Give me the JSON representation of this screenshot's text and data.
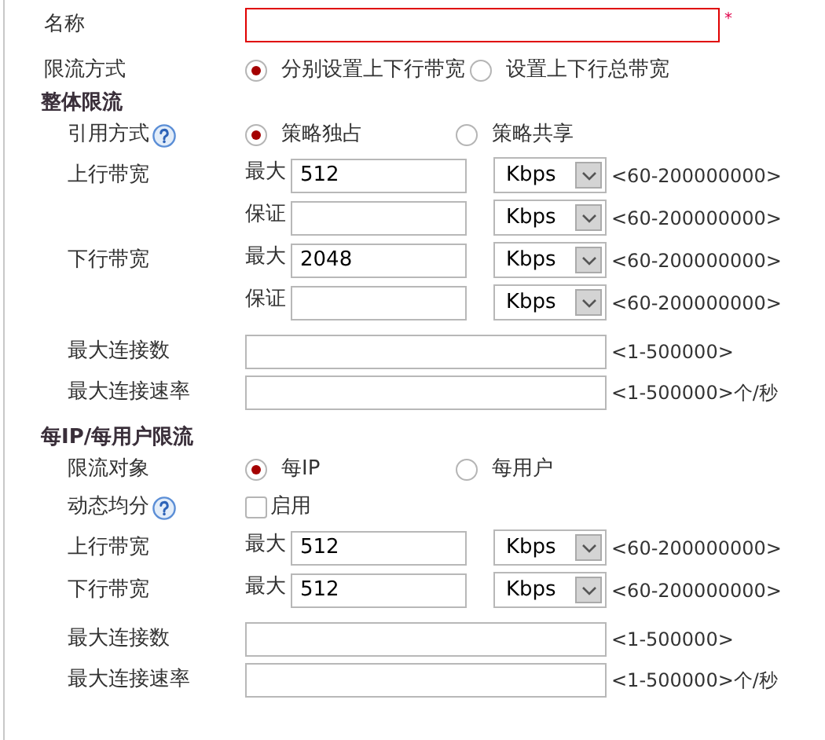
{
  "rows": [
    {
      "kind": "name",
      "label": "名称",
      "required_mark": "*",
      "invalid": true
    },
    {
      "kind": "radio",
      "label": "限流方式",
      "options": [
        {
          "label": "分别设置上下行带宽",
          "selected": true
        },
        {
          "label": "设置上下行总带宽",
          "selected": false
        }
      ]
    },
    {
      "kind": "heading",
      "label": "整体限流"
    },
    {
      "kind": "radio",
      "label": "引用方式",
      "help": true,
      "options": [
        {
          "label": "策略独占",
          "selected": true
        },
        {
          "label": "策略共享",
          "selected": false
        }
      ]
    },
    {
      "kind": "bandwidth",
      "label": "上行带宽",
      "lines": [
        {
          "sublabel": "最大",
          "value": "512",
          "unit": "Kbps",
          "range": "<60-200000000>"
        },
        {
          "sublabel": "保证",
          "unit": "Kbps",
          "range": "<60-200000000>"
        }
      ]
    },
    {
      "kind": "bandwidth",
      "label": "下行带宽",
      "lines": [
        {
          "sublabel": "最大",
          "value": "2048",
          "unit": "Kbps",
          "range": "<60-200000000>"
        },
        {
          "sublabel": "保证",
          "unit": "Kbps",
          "range": "<60-200000000>"
        }
      ]
    },
    {
      "kind": "wide",
      "label": "最大连接数",
      "range": "<1-500000>"
    },
    {
      "kind": "wide",
      "label": "最大连接速率",
      "range": "<1-500000>个/秒"
    },
    {
      "kind": "heading",
      "label": "每IP/每用户限流"
    },
    {
      "kind": "radio",
      "label": "限流对象",
      "options": [
        {
          "label": "每IP",
          "selected": true
        },
        {
          "label": "每用户",
          "selected": false
        }
      ]
    },
    {
      "kind": "checkbox",
      "label": "动态均分",
      "help": true,
      "option": "启用",
      "checked": false
    },
    {
      "kind": "bandwidth",
      "label": "上行带宽",
      "lines": [
        {
          "sublabel": "最大",
          "value": "512",
          "unit": "Kbps",
          "range": "<60-200000000>"
        }
      ]
    },
    {
      "kind": "bandwidth",
      "label": "下行带宽",
      "lines": [
        {
          "sublabel": "最大",
          "value": "512",
          "unit": "Kbps",
          "range": "<60-200000000>"
        }
      ]
    },
    {
      "kind": "wide",
      "label": "最大连接数",
      "range": "<1-500000>"
    },
    {
      "kind": "wide",
      "label": "最大连接速率",
      "range": "<1-500000>个/秒"
    }
  ]
}
